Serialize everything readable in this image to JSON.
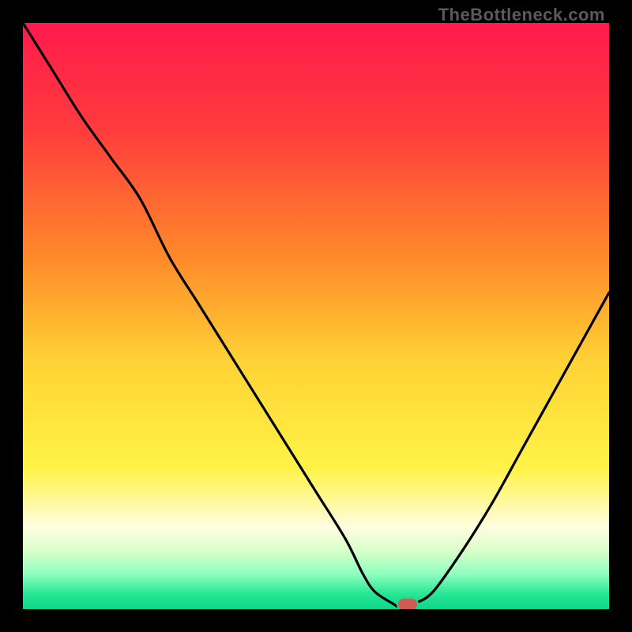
{
  "watermark": {
    "text": "TheBottleneck.com"
  },
  "colors": {
    "frame": "#000000",
    "gradient_stops": [
      {
        "pos": 0.0,
        "color": "#ff1a4d"
      },
      {
        "pos": 0.18,
        "color": "#ff3b3d"
      },
      {
        "pos": 0.4,
        "color": "#ff8a2a"
      },
      {
        "pos": 0.58,
        "color": "#ffd335"
      },
      {
        "pos": 0.76,
        "color": "#fff347"
      },
      {
        "pos": 0.86,
        "color": "#fffde0"
      },
      {
        "pos": 0.9,
        "color": "#d9ffc9"
      },
      {
        "pos": 0.94,
        "color": "#8fffbf"
      },
      {
        "pos": 0.975,
        "color": "#24e693"
      },
      {
        "pos": 1.0,
        "color": "#0fd68a"
      }
    ],
    "curve": "#000000",
    "marker_fill": "#d25a55",
    "marker_stroke": "#1fd68c"
  },
  "chart_data": {
    "type": "line",
    "title": "",
    "xlabel": "",
    "ylabel": "",
    "xlim": [
      0,
      100
    ],
    "ylim": [
      0,
      100
    ],
    "x": [
      0,
      5,
      10,
      15,
      20,
      25,
      30,
      35,
      40,
      45,
      50,
      55,
      58,
      60,
      63,
      65,
      67,
      70,
      75,
      80,
      85,
      90,
      95,
      100
    ],
    "values": [
      100,
      92,
      84,
      77,
      70,
      60,
      52,
      44,
      36,
      28,
      20,
      12,
      6,
      3,
      1,
      0,
      1,
      3,
      10,
      18,
      27,
      36,
      45,
      54
    ],
    "marker": {
      "x": 65.6,
      "y": 0.8
    },
    "legend": []
  }
}
